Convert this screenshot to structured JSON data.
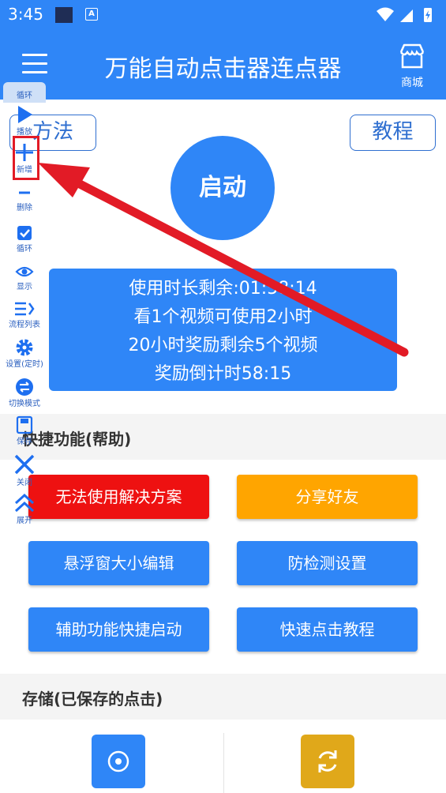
{
  "status": {
    "time": "3:45",
    "badge": "A"
  },
  "appbar": {
    "title": "万能自动点击器连点器",
    "shop_label": "商城"
  },
  "method_button": "方法",
  "tutorial_button": "教程",
  "start_button": "启动",
  "info": {
    "line1": "使用时长剩余:01:58:14",
    "line2": "看1个视频可使用2小时",
    "line3": "20小时奖励剩余5个视频",
    "line4": "奖励倒计时58:15"
  },
  "sections": {
    "quick": "快捷功能(帮助)",
    "storage": "存储(已保存的点击)"
  },
  "buttons": {
    "unusable": "无法使用解决方案",
    "share": "分享好友",
    "float_size": "悬浮窗大小编辑",
    "anti_detect": "防检测设置",
    "accessibility": "辅助功能快捷启动",
    "quick_tutorial": "快速点击教程"
  },
  "toolbar": {
    "top": "循环",
    "play": "播放",
    "add": "新增",
    "delete": "删除",
    "loop": "循环",
    "show": "显示",
    "process_list": "流程列表",
    "settings": "设置(定时)",
    "switch_mode": "切换模式",
    "save": "保存",
    "close": "关闭",
    "expand": "展开"
  },
  "colors": {
    "primary": "#2f86f7",
    "red": "#ee1111",
    "orange": "#ffa500",
    "gold": "#e0a81a",
    "annotation": "#e21b26"
  }
}
